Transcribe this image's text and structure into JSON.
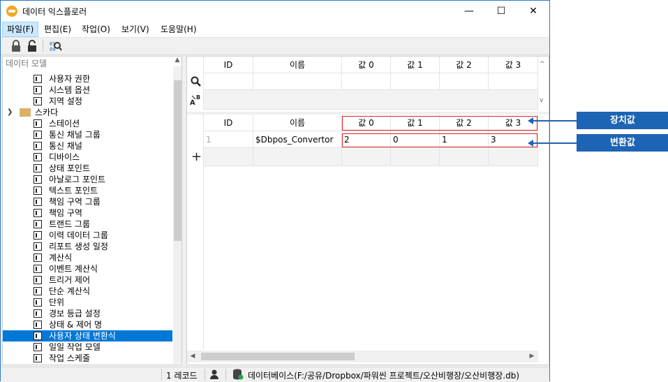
{
  "window": {
    "title": "데이터 익스플로러",
    "minimize": "—",
    "maximize": "☐",
    "close": "✕"
  },
  "menu": [
    {
      "label": "파일(F)"
    },
    {
      "label": "편집(E)"
    },
    {
      "label": "작업(O)"
    },
    {
      "label": "보기(V)"
    },
    {
      "label": "도움말(H)"
    }
  ],
  "tree": {
    "search_placeholder": "데이터 모델",
    "items": [
      {
        "label": "사용자 권한",
        "type": "leaf"
      },
      {
        "label": "시스템 옵션",
        "type": "leaf"
      },
      {
        "label": "지역 설정",
        "type": "leaf"
      },
      {
        "label": "스카다",
        "type": "folder"
      },
      {
        "label": "스테이션",
        "type": "leaf"
      },
      {
        "label": "통신 채널 그룹",
        "type": "leaf"
      },
      {
        "label": "통신 채널",
        "type": "leaf"
      },
      {
        "label": "디바이스",
        "type": "leaf"
      },
      {
        "label": "상태 포인트",
        "type": "leaf"
      },
      {
        "label": "아날로그 포인트",
        "type": "leaf"
      },
      {
        "label": "텍스트 포인트",
        "type": "leaf"
      },
      {
        "label": "책임 구역 그룹",
        "type": "leaf"
      },
      {
        "label": "책임 구역",
        "type": "leaf"
      },
      {
        "label": "트랜드 그룹",
        "type": "leaf"
      },
      {
        "label": "이력 데이터 그룹",
        "type": "leaf"
      },
      {
        "label": "리포트 생성 일정",
        "type": "leaf"
      },
      {
        "label": "계산식",
        "type": "leaf"
      },
      {
        "label": "이벤트 계산식",
        "type": "leaf"
      },
      {
        "label": "트리거 제어",
        "type": "leaf"
      },
      {
        "label": "단순 계산식",
        "type": "leaf"
      },
      {
        "label": "단위",
        "type": "leaf"
      },
      {
        "label": "경보 등급 설정",
        "type": "leaf"
      },
      {
        "label": "상태 & 제어 명",
        "type": "leaf"
      },
      {
        "label": "사용자 상태 변환식",
        "type": "leaf",
        "selected": true
      },
      {
        "label": "일일 작업 모델",
        "type": "leaf"
      },
      {
        "label": "작업 스케줄",
        "type": "leaf"
      }
    ]
  },
  "top_grid": {
    "headers": [
      "ID",
      "이름",
      "값 0",
      "값 1",
      "값 2",
      "값 3"
    ]
  },
  "bottom_grid": {
    "headers": [
      "ID",
      "이름",
      "값 0",
      "값 1",
      "값 2",
      "값 3"
    ],
    "row": {
      "num": "1",
      "id": "",
      "name": "$Dbpos_Convertor",
      "v0": "2",
      "v1": "0",
      "v2": "1",
      "v3": "3"
    }
  },
  "status": {
    "records": "1 레코드",
    "database": "데이터베이스(F:/공유/Dropbox/파워씬 프로젝트/오산비행장/오산비행장.db)"
  },
  "callouts": {
    "device_value": "장치값",
    "converted_value": "변환값"
  },
  "colors": {
    "accent": "#1e64b4",
    "highlight": "#d9242b",
    "selection": "#0078d7"
  }
}
